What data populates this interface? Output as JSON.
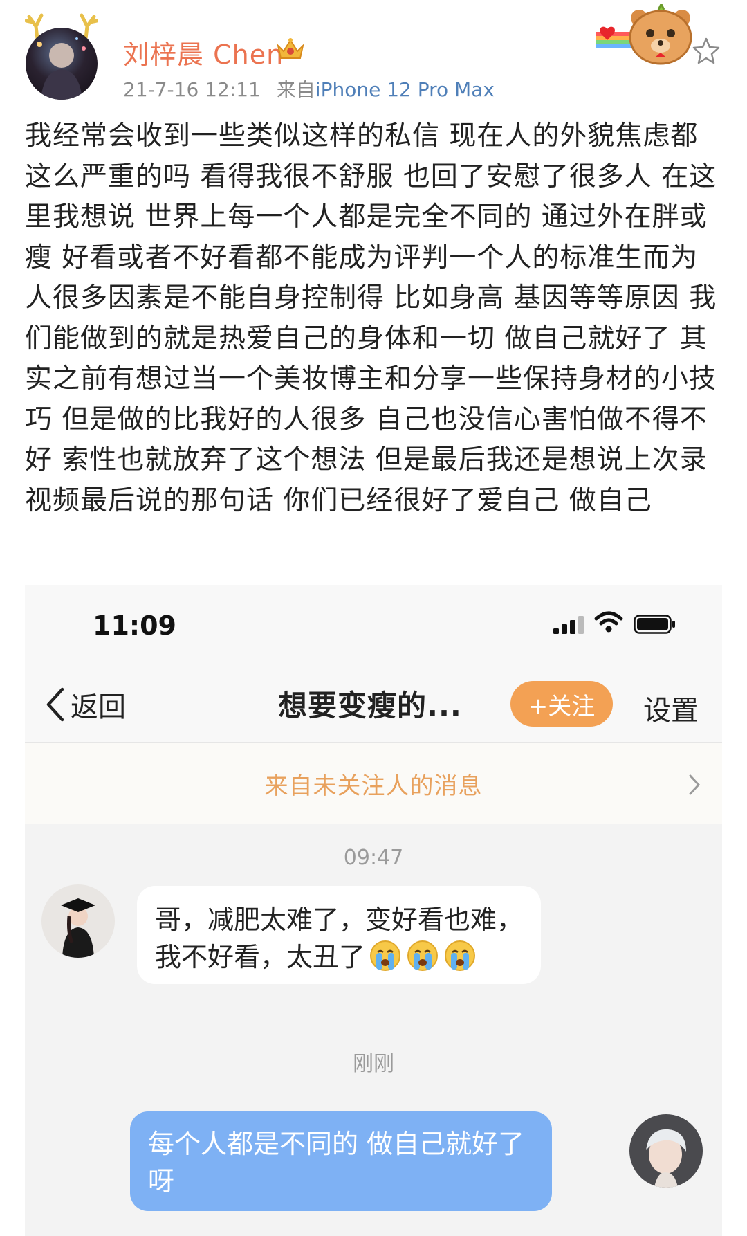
{
  "post": {
    "username": "刘梓晨 Chen",
    "date": "21-7-16 12:11",
    "source_prefix": "来自",
    "source_device": "iPhone 12 Pro Max",
    "body": "我经常会收到一些类似这样的私信 现在人的外貌焦虑都这么严重的吗 看得我很不舒服 也回了安慰了很多人 在这里我想说 世界上每一个人都是完全不同的 通过外在胖或瘦 好看或者不好看都不能成为评判一个人的标准生而为人很多因素是不能自身控制得 比如身高 基因等等原因 我们能做到的就是热爱自己的身体和一切 做自己就好了 其实之前有想过当一个美妆博主和分享一些保持身材的小技巧 但是做的比我好的人很多 自己也没信心害怕做不得不好 索性也就放弃了这个想法 但是最后我还是想说上次录视频最后说的那句话 你们已经很好了爱自己 做自己"
  },
  "chat": {
    "status_time": "11:09",
    "back_label": "返回",
    "title": "想要变瘦的...",
    "follow_label": "+关注",
    "settings_label": "设置",
    "notice": "来自未关注人的消息",
    "messages": [
      {
        "timestamp": "09:47",
        "direction": "incoming",
        "line1": "哥，减肥太难了，变好看也难，",
        "line2": "我不好看，太丑了",
        "emoji_count": 3
      },
      {
        "timestamp": "刚刚",
        "direction": "outgoing",
        "line1": "每个人都是不同的 做自己就好了",
        "line2": "呀"
      }
    ]
  },
  "colors": {
    "username": "#eb7350",
    "source_link": "#4f7fb8",
    "follow_button": "#f3a154",
    "notice_text": "#e8a15d",
    "outgoing_bubble": "#7eb1f4"
  },
  "icons": [
    "crown-badge-icon",
    "bear-sticker-icon",
    "favorite-star-icon",
    "back-chevron-icon",
    "signal-icon",
    "wifi-icon",
    "battery-icon",
    "chevron-right-icon",
    "crying-emoji-icon"
  ]
}
